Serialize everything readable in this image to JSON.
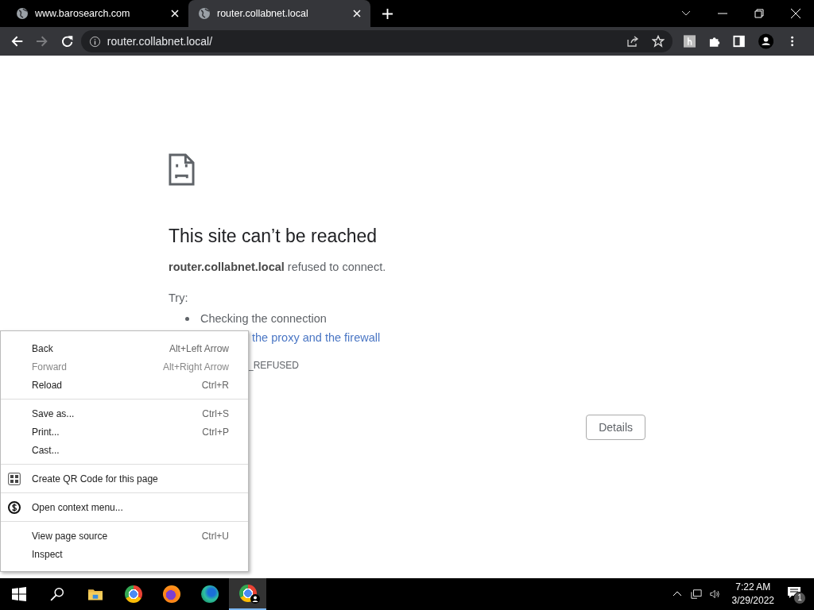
{
  "tabs": [
    {
      "title": "www.barosearch.com",
      "selected": false
    },
    {
      "title": "router.collabnet.local",
      "selected": true
    }
  ],
  "address_bar": {
    "url": "router.collabnet.local/"
  },
  "error_page": {
    "heading": "This site can’t be reached",
    "message": "**router.collabnet.local** refused to connect.",
    "try_label": "Try:",
    "suggestions": [
      {
        "text": "Checking the connection",
        "kind": "text"
      },
      {
        "text": "the proxy and the firewall",
        "kind": "link"
      }
    ],
    "error_code": "_REFUSED",
    "details_button": "Details"
  },
  "context_menu": {
    "groups": [
      [
        {
          "label": "Back",
          "shortcut": "Alt+Left Arrow",
          "disabled": false
        },
        {
          "label": "Forward",
          "shortcut": "Alt+Right Arrow",
          "disabled": true
        },
        {
          "label": "Reload",
          "shortcut": "Ctrl+R",
          "disabled": false
        }
      ],
      [
        {
          "label": "Save as...",
          "shortcut": "Ctrl+S",
          "disabled": false
        },
        {
          "label": "Print...",
          "shortcut": "Ctrl+P",
          "disabled": false
        },
        {
          "label": "Cast...",
          "disabled": false
        }
      ],
      [
        {
          "label": "Create QR Code for this page",
          "disabled": false
        }
      ],
      [
        {
          "label": "Open context menu...",
          "disabled": false
        }
      ],
      [
        {
          "label": "View page source",
          "shortcut": "Ctrl+U",
          "disabled": false
        },
        {
          "label": "Inspect",
          "disabled": false
        }
      ]
    ]
  },
  "taskbar": {
    "time": "7:22 AM",
    "date": "3/29/2022",
    "notification_count": "1"
  }
}
